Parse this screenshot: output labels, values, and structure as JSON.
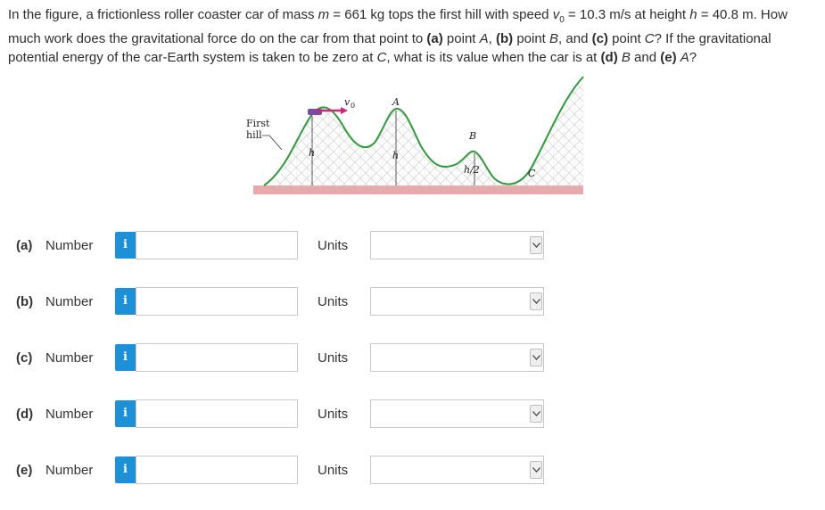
{
  "question": {
    "p1": "In the figure, a frictionless roller coaster car of mass ",
    "m_sym": "m",
    "p2": " = 661 kg tops the first hill with speed ",
    "v_sym": "v",
    "v_sub": "0",
    "p3": " = 10.3 m/s at height ",
    "h_sym": "h",
    "p4": " = 40.8 m. How much work does the gravitational force do on the car from that point to ",
    "a_tag": "(a)",
    "p5": " point ",
    "A_sym": "A",
    "p6": ", ",
    "b_tag": "(b)",
    "p7": " point ",
    "B_sym": "B",
    "p8": ", and ",
    "c_tag": "(c)",
    "p9": " point ",
    "C_sym": "C",
    "p10": "? If the gravitational potential energy of the car-Earth system is taken to be zero at ",
    "C2_sym": "C",
    "p11": ", what is its value when the car is at ",
    "d_tag": "(d)",
    "p12": " ",
    "B2_sym": "B",
    "p13": " and ",
    "e_tag": "(e)",
    "p14": " ",
    "A2_sym": "A",
    "p15": "?"
  },
  "figure": {
    "first_hill": "First",
    "first_hill_2": "hill",
    "v0": "v",
    "v0_sub": "0",
    "h_label_1": "h",
    "h_label_2": "h",
    "point_A": "A",
    "point_B": "B",
    "point_C": "C",
    "half_h": "h/2"
  },
  "rows": [
    {
      "part": "(a)",
      "number_label": "Number",
      "info": "i",
      "value": "",
      "units_label": "Units",
      "unit_value": ""
    },
    {
      "part": "(b)",
      "number_label": "Number",
      "info": "i",
      "value": "",
      "units_label": "Units",
      "unit_value": ""
    },
    {
      "part": "(c)",
      "number_label": "Number",
      "info": "i",
      "value": "",
      "units_label": "Units",
      "unit_value": ""
    },
    {
      "part": "(d)",
      "number_label": "Number",
      "info": "i",
      "value": "",
      "units_label": "Units",
      "unit_value": ""
    },
    {
      "part": "(e)",
      "number_label": "Number",
      "info": "i",
      "value": "",
      "units_label": "Units",
      "unit_value": ""
    }
  ],
  "colors": {
    "info_icon_bg": "#1e90d8",
    "track": "#2e9c3a",
    "ground": "#e7a9ab",
    "velocity_arrow": "#d0257a"
  }
}
